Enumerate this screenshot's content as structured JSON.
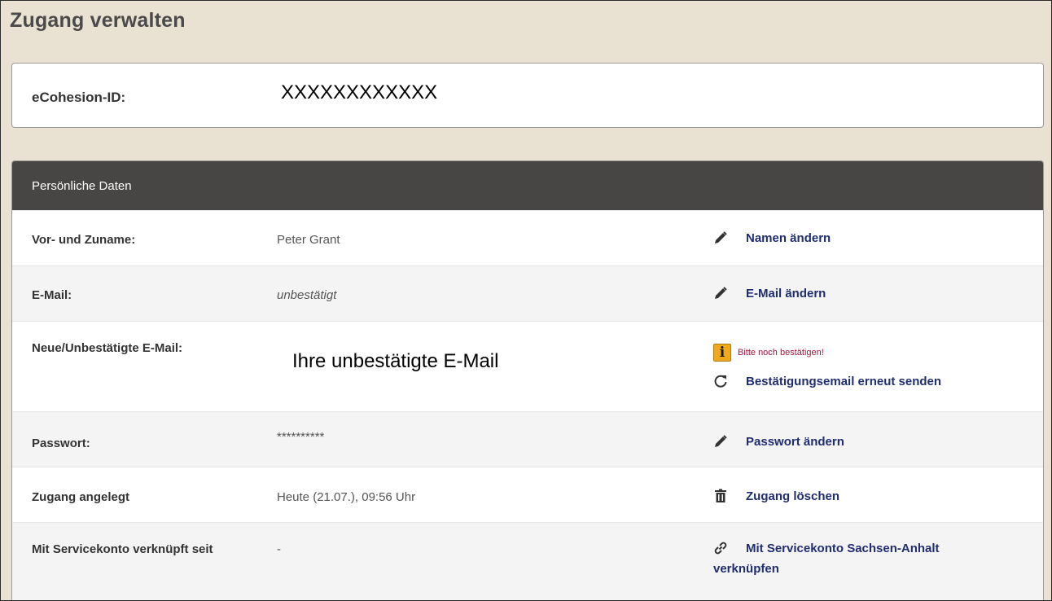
{
  "page": {
    "title": "Zugang verwalten"
  },
  "id_card": {
    "label": "eCohesion-ID:",
    "value": "XXXXXXXXXXXX"
  },
  "panel": {
    "title": "Persönliche Daten",
    "rows": [
      {
        "label": "Vor- und Zuname:",
        "value": "Peter Grant",
        "action": "Namen ändern",
        "icon": "pencil-icon"
      },
      {
        "label": "E-Mail:",
        "value": "unbestätigt",
        "action": "E-Mail ändern",
        "icon": "pencil-icon"
      },
      {
        "label": "Neue/Unbestätigte E-Mail:",
        "value": "Ihre unbestätigte E-Mail",
        "warning": "Bitte noch bestätigen!",
        "warning_icon": "info-icon",
        "action": "Bestätigungsemail erneut senden",
        "icon": "refresh-icon"
      },
      {
        "label": "Passwort:",
        "value": "**********",
        "action": "Passwort ändern",
        "icon": "pencil-icon"
      },
      {
        "label": "Zugang angelegt",
        "value": "Heute (21.07.), 09:56 Uhr",
        "action": "Zugang löschen",
        "icon": "trash-icon"
      },
      {
        "label": "Mit Servicekonto verknüpft seit",
        "value": "-",
        "action_line1": "Mit Servicekonto Sachsen-Anhalt",
        "action_line2": "verknüpfen",
        "icon": "link-icon"
      }
    ]
  },
  "colors": {
    "background": "#e9e1d2",
    "header": "#484644",
    "link": "#1f2d72",
    "warning": "#a3123b",
    "info": "#f0a81c"
  }
}
